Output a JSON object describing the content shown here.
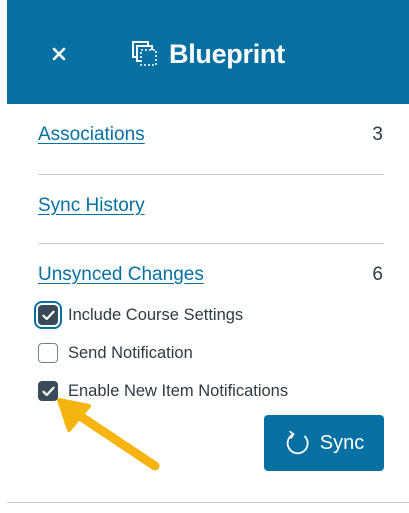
{
  "header": {
    "title": "Blueprint",
    "close_icon": "close-icon",
    "blueprint_icon": "blueprint-icon"
  },
  "links": [
    {
      "label": "Associations",
      "count": "3"
    },
    {
      "label": "Sync History",
      "count": ""
    },
    {
      "label": "Unsynced Changes",
      "count": "6"
    }
  ],
  "options": [
    {
      "label": "Include Course Settings",
      "checked": true
    },
    {
      "label": "Send Notification",
      "checked": false
    },
    {
      "label": "Enable New Item Notifications",
      "checked": true
    }
  ],
  "sync_button": {
    "label": "Sync",
    "icon": "sync-icon"
  },
  "colors": {
    "brand": "#0770a3",
    "text": "#2d3b45",
    "checkbox_checked": "#394b58",
    "annotation_arrow": "#f5b40f"
  }
}
